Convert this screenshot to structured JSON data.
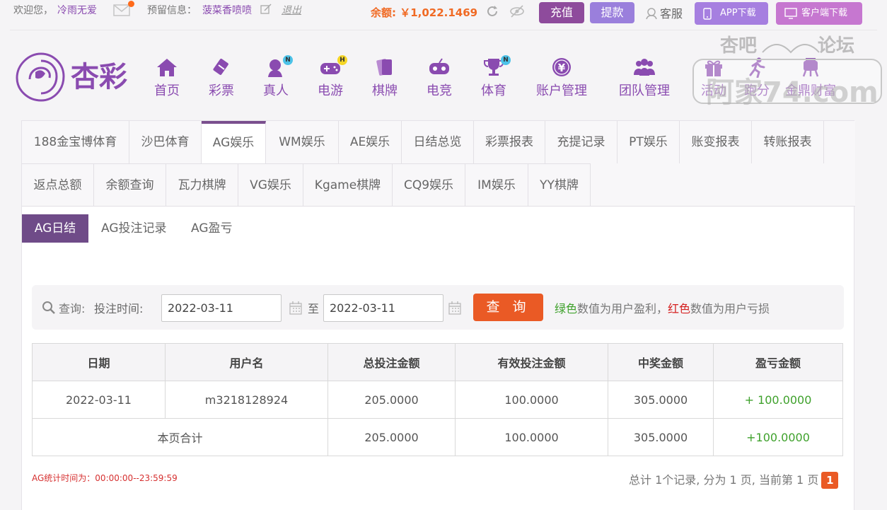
{
  "topbar": {
    "welcome": "欢迎您，",
    "username": "冷雨无爱",
    "reserve_label": "预留信息：",
    "reserve_value": "菠菜香喷喷",
    "logout": "退出",
    "balance": "余额: ￥1,022.1469",
    "charge": "充值",
    "withdraw": "提款",
    "customer_service": "客服",
    "app_download": "APP下载",
    "client_download": "客户端下载"
  },
  "nav": {
    "items": [
      {
        "label": "首页",
        "icon": "home-icon"
      },
      {
        "label": "彩票",
        "icon": "lottery-icon"
      },
      {
        "label": "真人",
        "icon": "live-dealer-icon",
        "badge": "N"
      },
      {
        "label": "电游",
        "icon": "gamepad-icon",
        "badge": "H"
      },
      {
        "label": "棋牌",
        "icon": "cards-icon"
      },
      {
        "label": "电竞",
        "icon": "esports-icon"
      },
      {
        "label": "体育",
        "icon": "trophy-icon",
        "badge": "N"
      },
      {
        "label": "账户管理",
        "icon": "yen-icon"
      },
      {
        "label": "团队管理",
        "icon": "team-icon"
      },
      {
        "label": "活动",
        "icon": "gift-icon"
      },
      {
        "label": "跑分",
        "icon": "run-icon"
      },
      {
        "label": "金鼎财富",
        "icon": "wealth-icon"
      }
    ]
  },
  "watermark": {
    "line1": "杏吧",
    "line2": "论坛",
    "line3": "阿家74.com"
  },
  "tabs": {
    "row1": [
      "188金宝博体育",
      "沙巴体育",
      "AG娱乐",
      "WM娱乐",
      "AE娱乐",
      "日结总览",
      "彩票报表",
      "充提记录",
      "PT娱乐",
      "账变报表",
      "转账报表"
    ],
    "row2": [
      "返点总额",
      "余额查询",
      "瓦力棋牌",
      "VG娱乐",
      "Kgame棋牌",
      "CQ9娱乐",
      "IM娱乐",
      "YY棋牌"
    ],
    "active": "AG娱乐"
  },
  "subtabs": [
    "AG日结",
    "AG投注记录",
    "AG盈亏"
  ],
  "query": {
    "label": "查询:",
    "time_label": "投注时间:",
    "start_date": "2022-03-11",
    "to": "至",
    "end_date": "2022-03-11",
    "button": "查 询",
    "tip_green": "绿色",
    "tip_mid": "数值为用户盈利，",
    "tip_red": "红色",
    "tip_end": "数值为用户亏损"
  },
  "table": {
    "headers": [
      "日期",
      "用户名",
      "总投注金额",
      "有效投注金额",
      "中奖金额",
      "盈亏金额"
    ],
    "row": {
      "date": "2022-03-11",
      "user": "m3218128924",
      "total": "205.0000",
      "valid": "100.0000",
      "win": "305.0000",
      "profit": "+ 100.0000"
    },
    "total_row": {
      "label": "本页合计",
      "total": "205.0000",
      "valid": "100.0000",
      "win": "305.0000",
      "profit": "+100.0000"
    }
  },
  "footer": {
    "stat_time": "AG统计时间为：00:00:00--23:59:59",
    "pager_text": "总计 1个记录, 分为 1 页, 当前第 1 页",
    "current_page": "1"
  },
  "colors": {
    "accent": "#8a4bb0",
    "orange": "#ea5a25",
    "green": "#3fa12c",
    "red": "#d52020"
  }
}
